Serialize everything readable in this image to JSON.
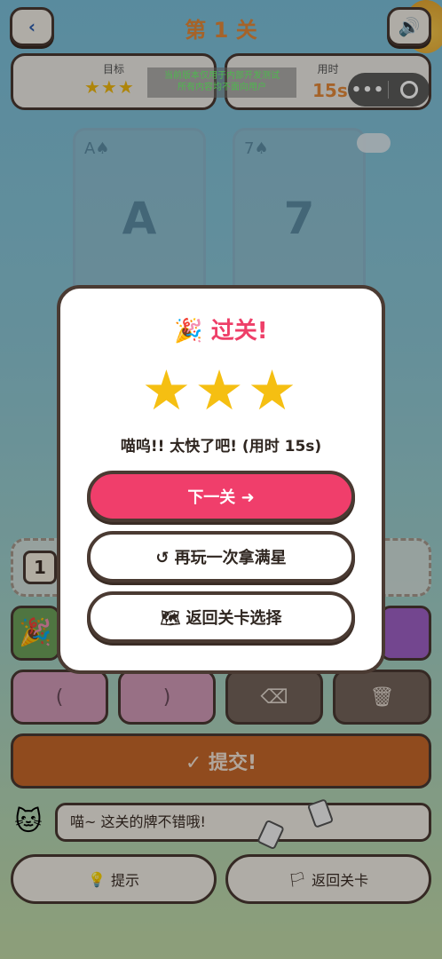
{
  "header": {
    "back_label": "‹",
    "title": "第 1 关",
    "sound_icon": "🔊"
  },
  "stats": {
    "goal_label": "目标",
    "goal_stars": "★★★",
    "time_label": "用时",
    "time_value": "15s"
  },
  "dev_notice": {
    "line1": "当前版本仅用于内部开发测试",
    "line2": "所有内容均不面向用户"
  },
  "capsule": {
    "menu": "•••"
  },
  "cards": [
    {
      "corner": "A♠",
      "center": "A"
    },
    {
      "corner": "7♠",
      "center": "7"
    }
  ],
  "slots": {
    "first": "1"
  },
  "tiles": {
    "party": "🎉"
  },
  "ops": {
    "open_paren": "(",
    "close_paren": ")",
    "backspace": "⌫",
    "trash": "🗑"
  },
  "submit_label": "✓ 提交!",
  "hint_bar": {
    "cat": "🐱",
    "message": "喵~ 这关的牌不错哦!"
  },
  "bottom": {
    "hint_icon": "💡",
    "hint_label": "提示",
    "back_icon": "🏳",
    "back_label": "返回关卡"
  },
  "modal": {
    "title": "🎉 过关!",
    "stars": "★★★",
    "message": "喵呜!! 太快了吧! (用时 15s)",
    "next_label": "下一关 ➜",
    "replay_label": "↺ 再玩一次拿满星",
    "levels_label": "🗺 返回关卡选择"
  },
  "colors": {
    "accent": "#f03e6b",
    "title_orange": "#e58a3a",
    "star": "#f5bf12",
    "submit": "#c8682a"
  }
}
